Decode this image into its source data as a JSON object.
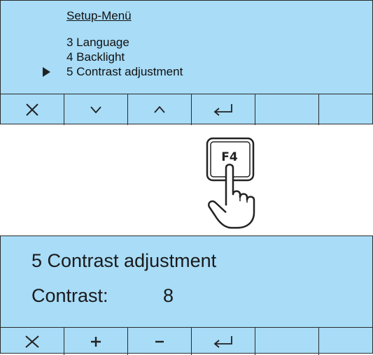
{
  "menu_screen": {
    "title": "Setup-Menü",
    "items": [
      {
        "label": "3 Language"
      },
      {
        "label": "4 Backlight"
      },
      {
        "label": "5 Contrast adjustment",
        "selected": true
      }
    ],
    "keys": [
      "close-icon",
      "chevron-down-icon",
      "chevron-up-icon",
      "enter-icon",
      "",
      ""
    ]
  },
  "f4_key": {
    "label": "F4"
  },
  "contrast_screen": {
    "title": "5 Contrast adjustment",
    "label": "Contrast:",
    "value": "8",
    "keys": [
      "close-icon",
      "plus-icon",
      "minus-icon",
      "enter-icon",
      "",
      ""
    ]
  },
  "colors": {
    "panel_background": "#a8dcf7",
    "border": "#2b2b2b",
    "text": "#111111"
  }
}
